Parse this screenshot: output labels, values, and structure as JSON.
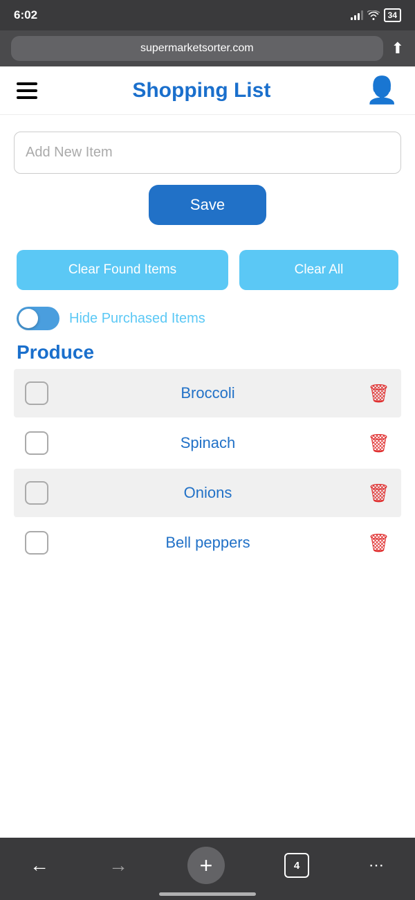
{
  "statusBar": {
    "time": "6:02",
    "battery": "34"
  },
  "browserBar": {
    "url": "supermarketsorter.com"
  },
  "header": {
    "title": "Shopping List"
  },
  "addItem": {
    "placeholder": "Add New Item"
  },
  "buttons": {
    "save": "Save",
    "clearFound": "Clear Found Items",
    "clearAll": "Clear All"
  },
  "toggle": {
    "label": "Hide Purchased Items"
  },
  "section": {
    "produce": "Produce"
  },
  "items": [
    {
      "name": "Broccoli"
    },
    {
      "name": "Spinach"
    },
    {
      "name": "Onions"
    },
    {
      "name": "Bell peppers"
    }
  ],
  "bottomNav": {
    "tabCount": "4"
  }
}
